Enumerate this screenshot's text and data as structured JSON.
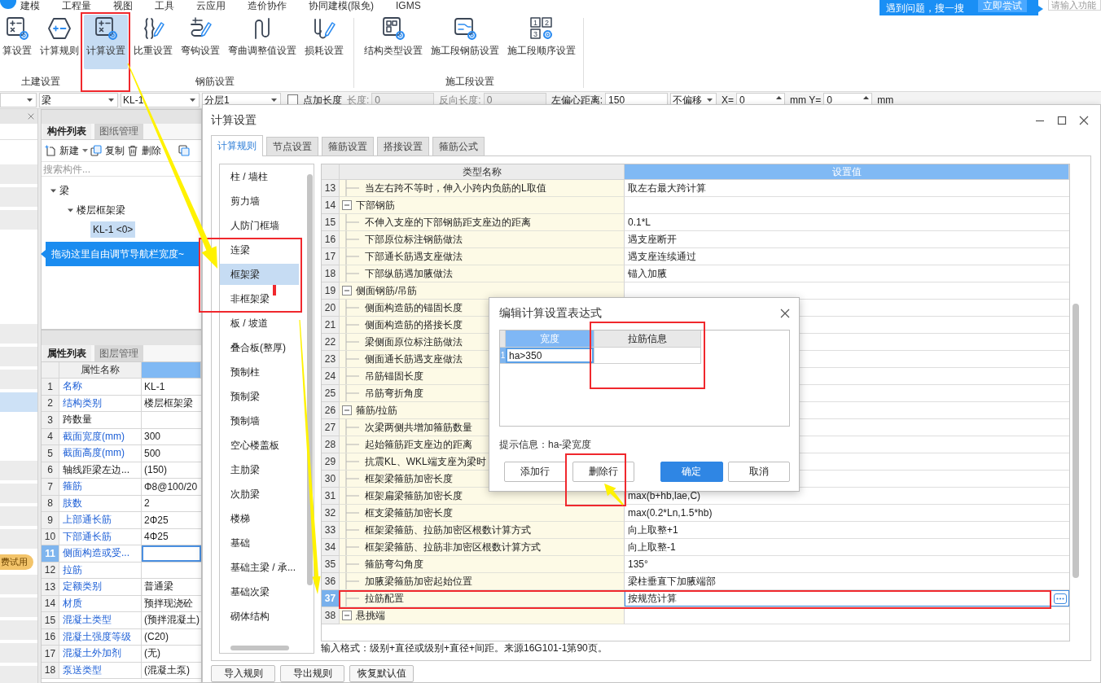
{
  "menu": {
    "items": [
      "建模",
      "工程量",
      "视图",
      "工具",
      "云应用",
      "造价协作",
      "协同建模(限免)",
      "IGMS"
    ]
  },
  "help_banner": {
    "text": "遇到问题，搜一搜",
    "button": "立即尝试"
  },
  "function_search": {
    "placeholder": "请输入功能"
  },
  "ribbon": {
    "groups": [
      {
        "label": "土建设置",
        "buttons": [
          {
            "label": "算设置",
            "kind": "calc",
            "selected": false
          },
          {
            "label": "计算规则",
            "kind": "rules",
            "selected": false
          }
        ]
      },
      {
        "label": "钢筋设置",
        "buttons": [
          {
            "label": "计算设置",
            "kind": "calc",
            "selected": true
          },
          {
            "label": "比重设置",
            "kind": "weight",
            "selected": false
          },
          {
            "label": "弯钩设置",
            "kind": "hook",
            "selected": false
          },
          {
            "label": "弯曲调整值设置",
            "kind": "bend",
            "selected": false
          },
          {
            "label": "损耗设置",
            "kind": "loss",
            "selected": false
          }
        ]
      },
      {
        "label": "施工段设置",
        "buttons": [
          {
            "label": "结构类型设置",
            "kind": "structure",
            "selected": false
          },
          {
            "label": "施工段钢筋设置",
            "kind": "segment",
            "selected": false
          },
          {
            "label": "施工段顺序设置",
            "kind": "order",
            "selected": false,
            "icon_text": [
              "1",
              "2",
              "3"
            ]
          }
        ]
      }
    ]
  },
  "toolbar": {
    "selectors": [
      {
        "kind": "combo"
      },
      {
        "kind": "combo",
        "value": "梁"
      },
      {
        "kind": "combo",
        "value": "KL-1"
      },
      {
        "kind": "combo",
        "value": "分层1"
      }
    ],
    "options": [
      {
        "kind": "checkbox",
        "label": "点加长度",
        "checked": false
      },
      {
        "kind": "input",
        "label": "长度:",
        "value": "0",
        "disabled": true
      },
      {
        "kind": "input",
        "label": "反向长度:",
        "value": "0",
        "disabled": true
      },
      {
        "kind": "input",
        "label": "左偏心距离:",
        "value": "150",
        "disabled": false
      },
      {
        "kind": "combo",
        "value": "不偏移"
      },
      {
        "kind": "spin",
        "label": "X=",
        "value": "0"
      },
      {
        "kind": "spin",
        "label": "mm Y=",
        "value": "0"
      },
      {
        "kind": "text",
        "label": "mm"
      }
    ]
  },
  "left_nav": {
    "rows": [
      {
        "kind": "blank"
      },
      {
        "kind": "band",
        "selected": false
      },
      {
        "kind": "band",
        "selected": false
      },
      {
        "kind": "band",
        "selected": false
      },
      {
        "kind": "blank"
      },
      {
        "kind": "blank"
      },
      {
        "kind": "blank"
      },
      {
        "kind": "blank"
      },
      {
        "kind": "band",
        "selected": false
      },
      {
        "kind": "band",
        "selected": false
      },
      {
        "kind": "band",
        "selected": false
      },
      {
        "kind": "band",
        "selected": true
      },
      {
        "kind": "blank"
      },
      {
        "kind": "blank"
      },
      {
        "kind": "band",
        "selected": false
      },
      {
        "kind": "band",
        "selected": false
      },
      {
        "kind": "band",
        "selected": false
      },
      {
        "kind": "band",
        "selected": false
      },
      {
        "kind": "badge",
        "badge": "费试用"
      },
      {
        "kind": "band",
        "selected": false
      },
      {
        "kind": "band",
        "selected": false
      },
      {
        "kind": "band",
        "selected": false
      },
      {
        "kind": "band",
        "selected": false
      },
      {
        "kind": "band",
        "selected": false
      }
    ]
  },
  "component_panel": {
    "tabs": [
      {
        "label": "构件列表",
        "selected": true
      },
      {
        "label": "图纸管理",
        "selected": false
      }
    ],
    "actions": [
      {
        "kind": "new",
        "label": "新建",
        "dropdown": true
      },
      {
        "kind": "copy",
        "label": "复制"
      },
      {
        "kind": "delete",
        "label": "删除"
      },
      {
        "kind": "stack"
      }
    ],
    "search": {
      "placeholder": "搜索构件..."
    },
    "tree": [
      {
        "label": "梁",
        "expanded": true,
        "selected": false,
        "children": [
          {
            "label": "楼层框架梁",
            "expanded": true,
            "selected": false,
            "children": [
              {
                "label": "KL-1 <0>",
                "selected": true
              }
            ]
          }
        ]
      }
    ],
    "tooltip": "拖动这里自由调节导航栏宽度~"
  },
  "property_panel": {
    "tabs": [
      {
        "label": "属性列表",
        "selected": true
      },
      {
        "label": "图层管理",
        "selected": false
      }
    ],
    "columns": [
      {
        "label": "属性名称",
        "selected": false
      },
      {
        "selected": true
      }
    ],
    "rows": [
      {
        "num": "1",
        "name": "名称",
        "value": "KL-1",
        "public": true,
        "selected": false
      },
      {
        "num": "2",
        "name": "结构类别",
        "value": "楼层框架梁",
        "public": true,
        "selected": false
      },
      {
        "num": "3",
        "name": "跨数量",
        "public": false,
        "selected": false
      },
      {
        "num": "4",
        "name": "截面宽度(mm)",
        "value": "300",
        "public": true,
        "selected": false
      },
      {
        "num": "5",
        "name": "截面高度(mm)",
        "value": "500",
        "public": true,
        "selected": false
      },
      {
        "num": "6",
        "name": "轴线距梁左边...",
        "value": "(150)",
        "public": false,
        "selected": false
      },
      {
        "num": "7",
        "name": "箍筋",
        "value": "Φ8@100/20",
        "public": true,
        "selected": false
      },
      {
        "num": "8",
        "name": "肢数",
        "value": "2",
        "public": true,
        "selected": false
      },
      {
        "num": "9",
        "name": "上部通长筋",
        "value": "2Φ25",
        "public": true,
        "selected": false
      },
      {
        "num": "10",
        "name": "下部通长筋",
        "value": "4Φ25",
        "public": true,
        "selected": false
      },
      {
        "num": "11",
        "name": "侧面构造或受...",
        "public": true,
        "selected": true
      },
      {
        "num": "12",
        "name": "拉筋",
        "public": true,
        "selected": false
      },
      {
        "num": "13",
        "name": "定额类别",
        "value": "普通梁",
        "public": true,
        "selected": false
      },
      {
        "num": "14",
        "name": "材质",
        "value": "预拌现浇砼",
        "public": true,
        "selected": false
      },
      {
        "num": "15",
        "name": "混凝土类型",
        "value": "(预拌混凝土)",
        "public": true,
        "selected": false
      },
      {
        "num": "16",
        "name": "混凝土强度等级",
        "value": "(C20)",
        "public": true,
        "selected": false
      },
      {
        "num": "17",
        "name": "混凝土外加剂",
        "value": "(无)",
        "public": true,
        "selected": false
      },
      {
        "num": "18",
        "name": "泵送类型",
        "value": "(混凝土泵)",
        "public": true,
        "selected": false
      }
    ]
  },
  "settings_dialog": {
    "title": "计算设置",
    "tabs": [
      {
        "label": "计算规则",
        "selected": true
      },
      {
        "label": "节点设置",
        "selected": false
      },
      {
        "label": "箍筋设置",
        "selected": false
      },
      {
        "label": "搭接设置",
        "selected": false
      },
      {
        "label": "箍筋公式",
        "selected": false
      }
    ],
    "categories": [
      {
        "label": "柱 / 墙柱",
        "selected": false
      },
      {
        "label": "剪力墙",
        "selected": false
      },
      {
        "label": "人防门框墙",
        "selected": false
      },
      {
        "label": "连梁",
        "selected": false
      },
      {
        "label": "框架梁",
        "selected": true
      },
      {
        "label": "非框架梁",
        "selected": false
      },
      {
        "label": "板 / 坡道",
        "selected": false
      },
      {
        "label": "叠合板(整厚)",
        "selected": false
      },
      {
        "label": "预制柱",
        "selected": false
      },
      {
        "label": "预制梁",
        "selected": false
      },
      {
        "label": "预制墙",
        "selected": false
      },
      {
        "label": "空心楼盖板",
        "selected": false
      },
      {
        "label": "主肋梁",
        "selected": false
      },
      {
        "label": "次肋梁",
        "selected": false
      },
      {
        "label": "楼梯",
        "selected": false
      },
      {
        "label": "基础",
        "selected": false
      },
      {
        "label": "基础主梁 / 承...",
        "selected": false
      },
      {
        "label": "基础次梁",
        "selected": false
      },
      {
        "label": "砌体结构",
        "selected": false
      }
    ],
    "table": {
      "columns": [
        {
          "label": "类型名称",
          "selected": false
        },
        {
          "label": "设置值",
          "selected": true
        }
      ],
      "rows": [
        {
          "num": "13",
          "kind": "item",
          "name": "当左右跨不等时，伸入小跨内负筋的L取值",
          "value": "取左右最大跨计算",
          "selected": false
        },
        {
          "num": "14",
          "kind": "group",
          "name": "下部钢筋",
          "expanded": true,
          "selected": false
        },
        {
          "num": "15",
          "kind": "item",
          "name": "不伸入支座的下部钢筋距支座边的距离",
          "value": "0.1*L",
          "selected": false
        },
        {
          "num": "16",
          "kind": "item",
          "name": "下部原位标注钢筋做法",
          "value": "遇支座断开",
          "selected": false
        },
        {
          "num": "17",
          "kind": "item",
          "name": "下部通长筋遇支座做法",
          "value": "遇支座连续通过",
          "selected": false
        },
        {
          "num": "18",
          "kind": "item",
          "name": "下部纵筋遇加腋做法",
          "value": "锚入加腋",
          "selected": false
        },
        {
          "num": "19",
          "kind": "group",
          "name": "侧面钢筋/吊筋",
          "expanded": true,
          "selected": false
        },
        {
          "num": "20",
          "kind": "item",
          "name": "侧面构造筋的锚固长度",
          "selected": false
        },
        {
          "num": "21",
          "kind": "item",
          "name": "侧面构造筋的搭接长度",
          "selected": false
        },
        {
          "num": "22",
          "kind": "item",
          "name": "梁侧面原位标注筋做法",
          "selected": false
        },
        {
          "num": "23",
          "kind": "item",
          "name": "侧面通长筋遇支座做法",
          "selected": false
        },
        {
          "num": "24",
          "kind": "item",
          "name": "吊筋锚固长度",
          "selected": false
        },
        {
          "num": "25",
          "kind": "item",
          "name": "吊筋弯折角度",
          "selected": false
        },
        {
          "num": "26",
          "kind": "group",
          "name": "箍筋/拉筋",
          "expanded": true,
          "selected": false
        },
        {
          "num": "27",
          "kind": "item",
          "name": "次梁两侧共增加箍筋数量",
          "selected": false
        },
        {
          "num": "28",
          "kind": "item",
          "name": "起始箍筋距支座边的距离",
          "selected": false
        },
        {
          "num": "29",
          "kind": "item",
          "name": "抗震KL、WKL端支座为梁时",
          "selected": false
        },
        {
          "num": "30",
          "kind": "item",
          "name": "框架梁箍筋加密长度",
          "selected": false
        },
        {
          "num": "31",
          "kind": "item",
          "name": "框架扁梁箍筋加密长度",
          "value": "max(b+hb,lae,C)",
          "selected": false
        },
        {
          "num": "32",
          "kind": "item",
          "name": "框支梁箍筋加密长度",
          "value": "max(0.2*Ln,1.5*hb)",
          "selected": false
        },
        {
          "num": "33",
          "kind": "item",
          "name": "框架梁箍筋、拉筋加密区根数计算方式",
          "value": "向上取整+1",
          "selected": false
        },
        {
          "num": "34",
          "kind": "item",
          "name": "框架梁箍筋、拉筋非加密区根数计算方式",
          "value": "向上取整-1",
          "selected": false
        },
        {
          "num": "35",
          "kind": "item",
          "name": "箍筋弯勾角度",
          "value": "135°",
          "selected": false
        },
        {
          "num": "36",
          "kind": "item",
          "name": "加腋梁箍筋加密起始位置",
          "value": "梁柱垂直下加腋端部",
          "selected": false
        },
        {
          "num": "37",
          "kind": "item",
          "name": "拉筋配置",
          "value": "按规范计算",
          "selected": true
        },
        {
          "num": "38",
          "kind": "group",
          "name": "悬挑端",
          "expanded": true,
          "selected": false
        }
      ]
    },
    "note": "输入格式：级别+直径或级别+直径+间距。来源16G101-1第90页。",
    "buttons": [
      "导入规则",
      "导出规则",
      "恢复默认值"
    ]
  },
  "expression_dialog": {
    "title": "编辑计算设置表达式",
    "columns": [
      {
        "label": "宽度",
        "selected": true
      },
      {
        "label": "拉筋信息",
        "selected": false
      }
    ],
    "rows": [
      {
        "num": "1",
        "cells": [
          "ha>350"
        ],
        "selected": true
      }
    ],
    "hint": "提示信息：ha-梁宽度",
    "buttons": [
      {
        "label": "添加行",
        "primary": false
      },
      {
        "label": "删除行",
        "primary": false
      },
      {
        "label": "确定",
        "primary": true
      },
      {
        "label": "取消",
        "primary": false
      }
    ]
  }
}
